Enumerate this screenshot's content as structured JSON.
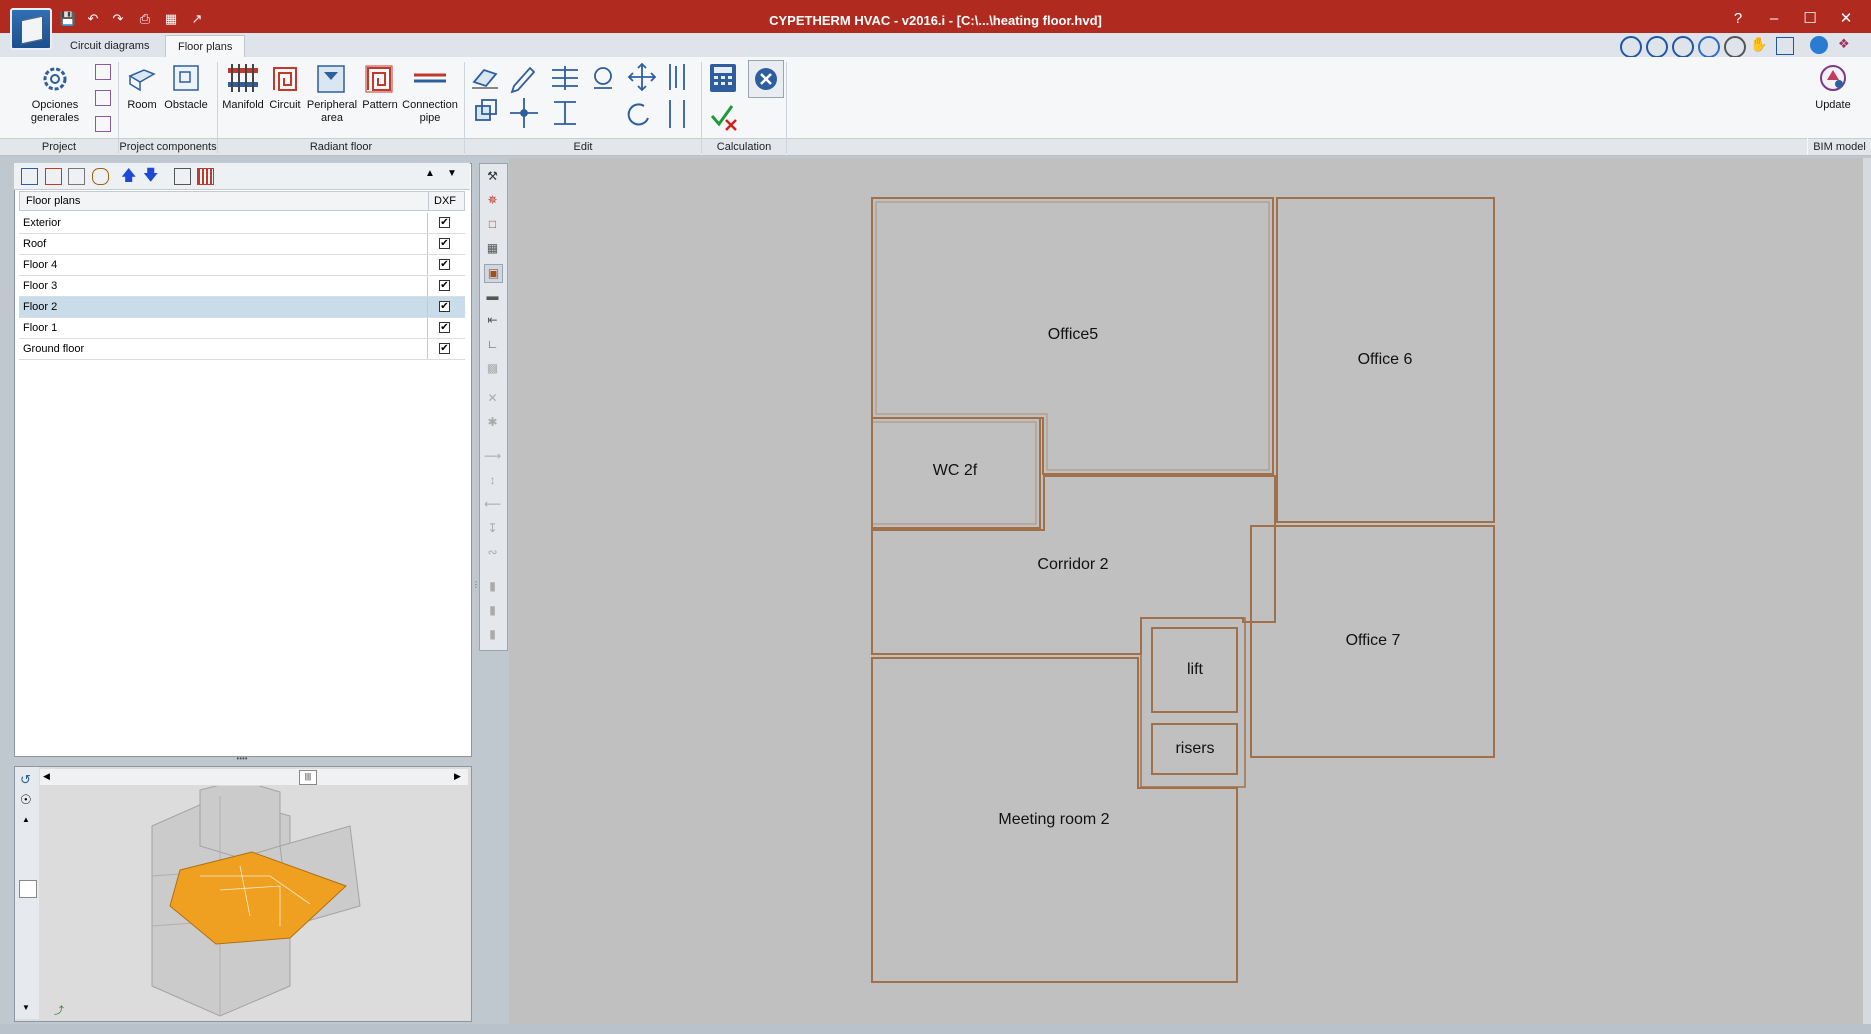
{
  "window": {
    "title": "CYPETHERM HVAC - v2016.i - [C:\\...\\heating floor.hvd]",
    "help": "?",
    "minimize": "–",
    "maximize": "☐",
    "close": "✕"
  },
  "tabs": [
    "Circuit diagrams",
    "Floor plans"
  ],
  "ribbon": {
    "project": {
      "label": "Project",
      "general_options": "Opciones generales"
    },
    "project_components": {
      "label": "Project components",
      "room": "Room",
      "obstacle": "Obstacle"
    },
    "radiant_floor": {
      "label": "Radiant floor",
      "manifold": "Manifold",
      "circuit": "Circuit",
      "peripheral_area": "Peripheral area",
      "pattern": "Pattern",
      "connection_pipe": "Connection pipe"
    },
    "edit": {
      "label": "Edit"
    },
    "calculation": {
      "label": "Calculation"
    },
    "bim_model": {
      "label": "BIM model",
      "update": "Update"
    }
  },
  "floor_plans": {
    "header": "Floor plans",
    "dxf_header": "DXF",
    "rows": [
      {
        "name": "Exterior",
        "dxf": "✔"
      },
      {
        "name": "Roof",
        "dxf": "✔"
      },
      {
        "name": "Floor 4",
        "dxf": "✔"
      },
      {
        "name": "Floor 3",
        "dxf": "✔"
      },
      {
        "name": "Floor 2",
        "dxf": "✔"
      },
      {
        "name": "Floor 1",
        "dxf": "✔"
      },
      {
        "name": "Ground floor",
        "dxf": "✔"
      }
    ],
    "selected": "Floor 2"
  },
  "rooms": {
    "office5": "Office5",
    "office6": "Office 6",
    "wc2f": "WC 2f",
    "corridor2": "Corridor 2",
    "lift": "lift",
    "office7": "Office 7",
    "risers": "risers",
    "meeting2": "Meeting room 2"
  },
  "colors": {
    "titlebar": "#b12a1f",
    "room_outline": "#a0704a",
    "canvas": "#c0c0c0",
    "selection": "#c9dcea",
    "slab_highlight": "#f0a020"
  }
}
